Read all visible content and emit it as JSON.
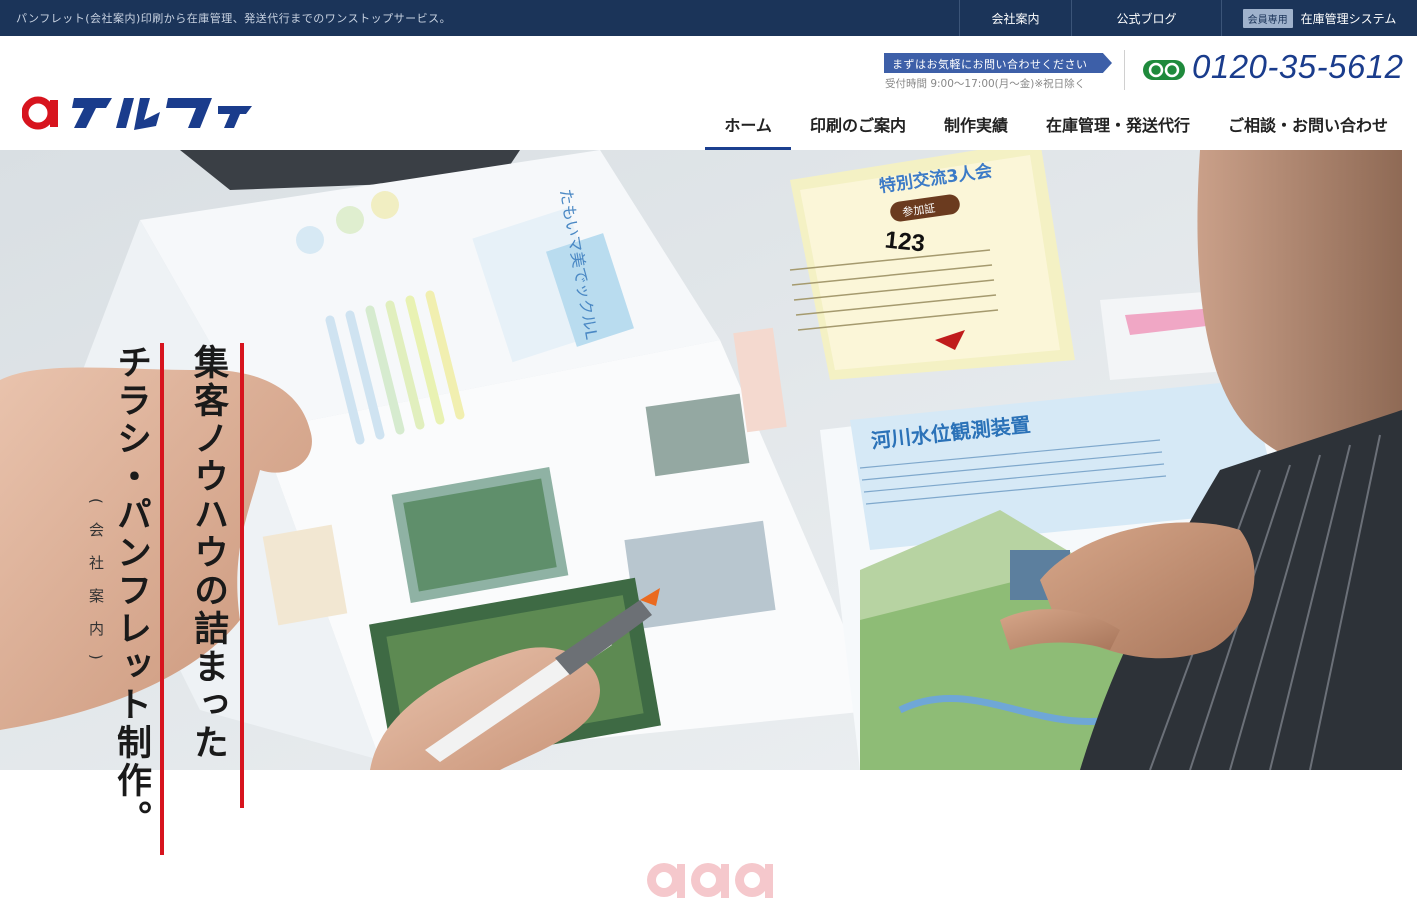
{
  "topbar": {
    "tagline": "パンフレット(会社案内)印刷から在庫管理、発送代行までのワンストップサービス。",
    "links": {
      "company": "会社案内",
      "blog": "公式ブログ",
      "member_badge": "会員専用",
      "system": "在庫管理システム"
    }
  },
  "header": {
    "logo_text": "アルファ",
    "contact_banner": "まずはお気軽にお問い合わせください",
    "hours": "受付時間 9:00〜17:00(月〜金)※祝日除く",
    "phone": "0120-35-5612",
    "phone_icon": "freedial-icon"
  },
  "nav": {
    "items": [
      {
        "label": "ホーム",
        "active": true
      },
      {
        "label": "印刷のご案内",
        "active": false
      },
      {
        "label": "制作実績",
        "active": false
      },
      {
        "label": "在庫管理・発送代行",
        "active": false
      },
      {
        "label": "ご相談・お問い合わせ",
        "active": false
      }
    ]
  },
  "hero": {
    "copy_line1": "集客ノウハウの詰まった",
    "copy_line2": "チラシ・パンフレット制作。",
    "copy_sub": "(会社案内)",
    "pamphlet_title": "河川水位観測装置",
    "ticket_title": "特別交流3人会",
    "ticket_sub": "参加証",
    "ticket_number": "123"
  },
  "colors": {
    "topbar_bg": "#1b3459",
    "brand_blue": "#1a3c8c",
    "brand_red": "#d7141e",
    "accent_line": "#d7141e"
  }
}
